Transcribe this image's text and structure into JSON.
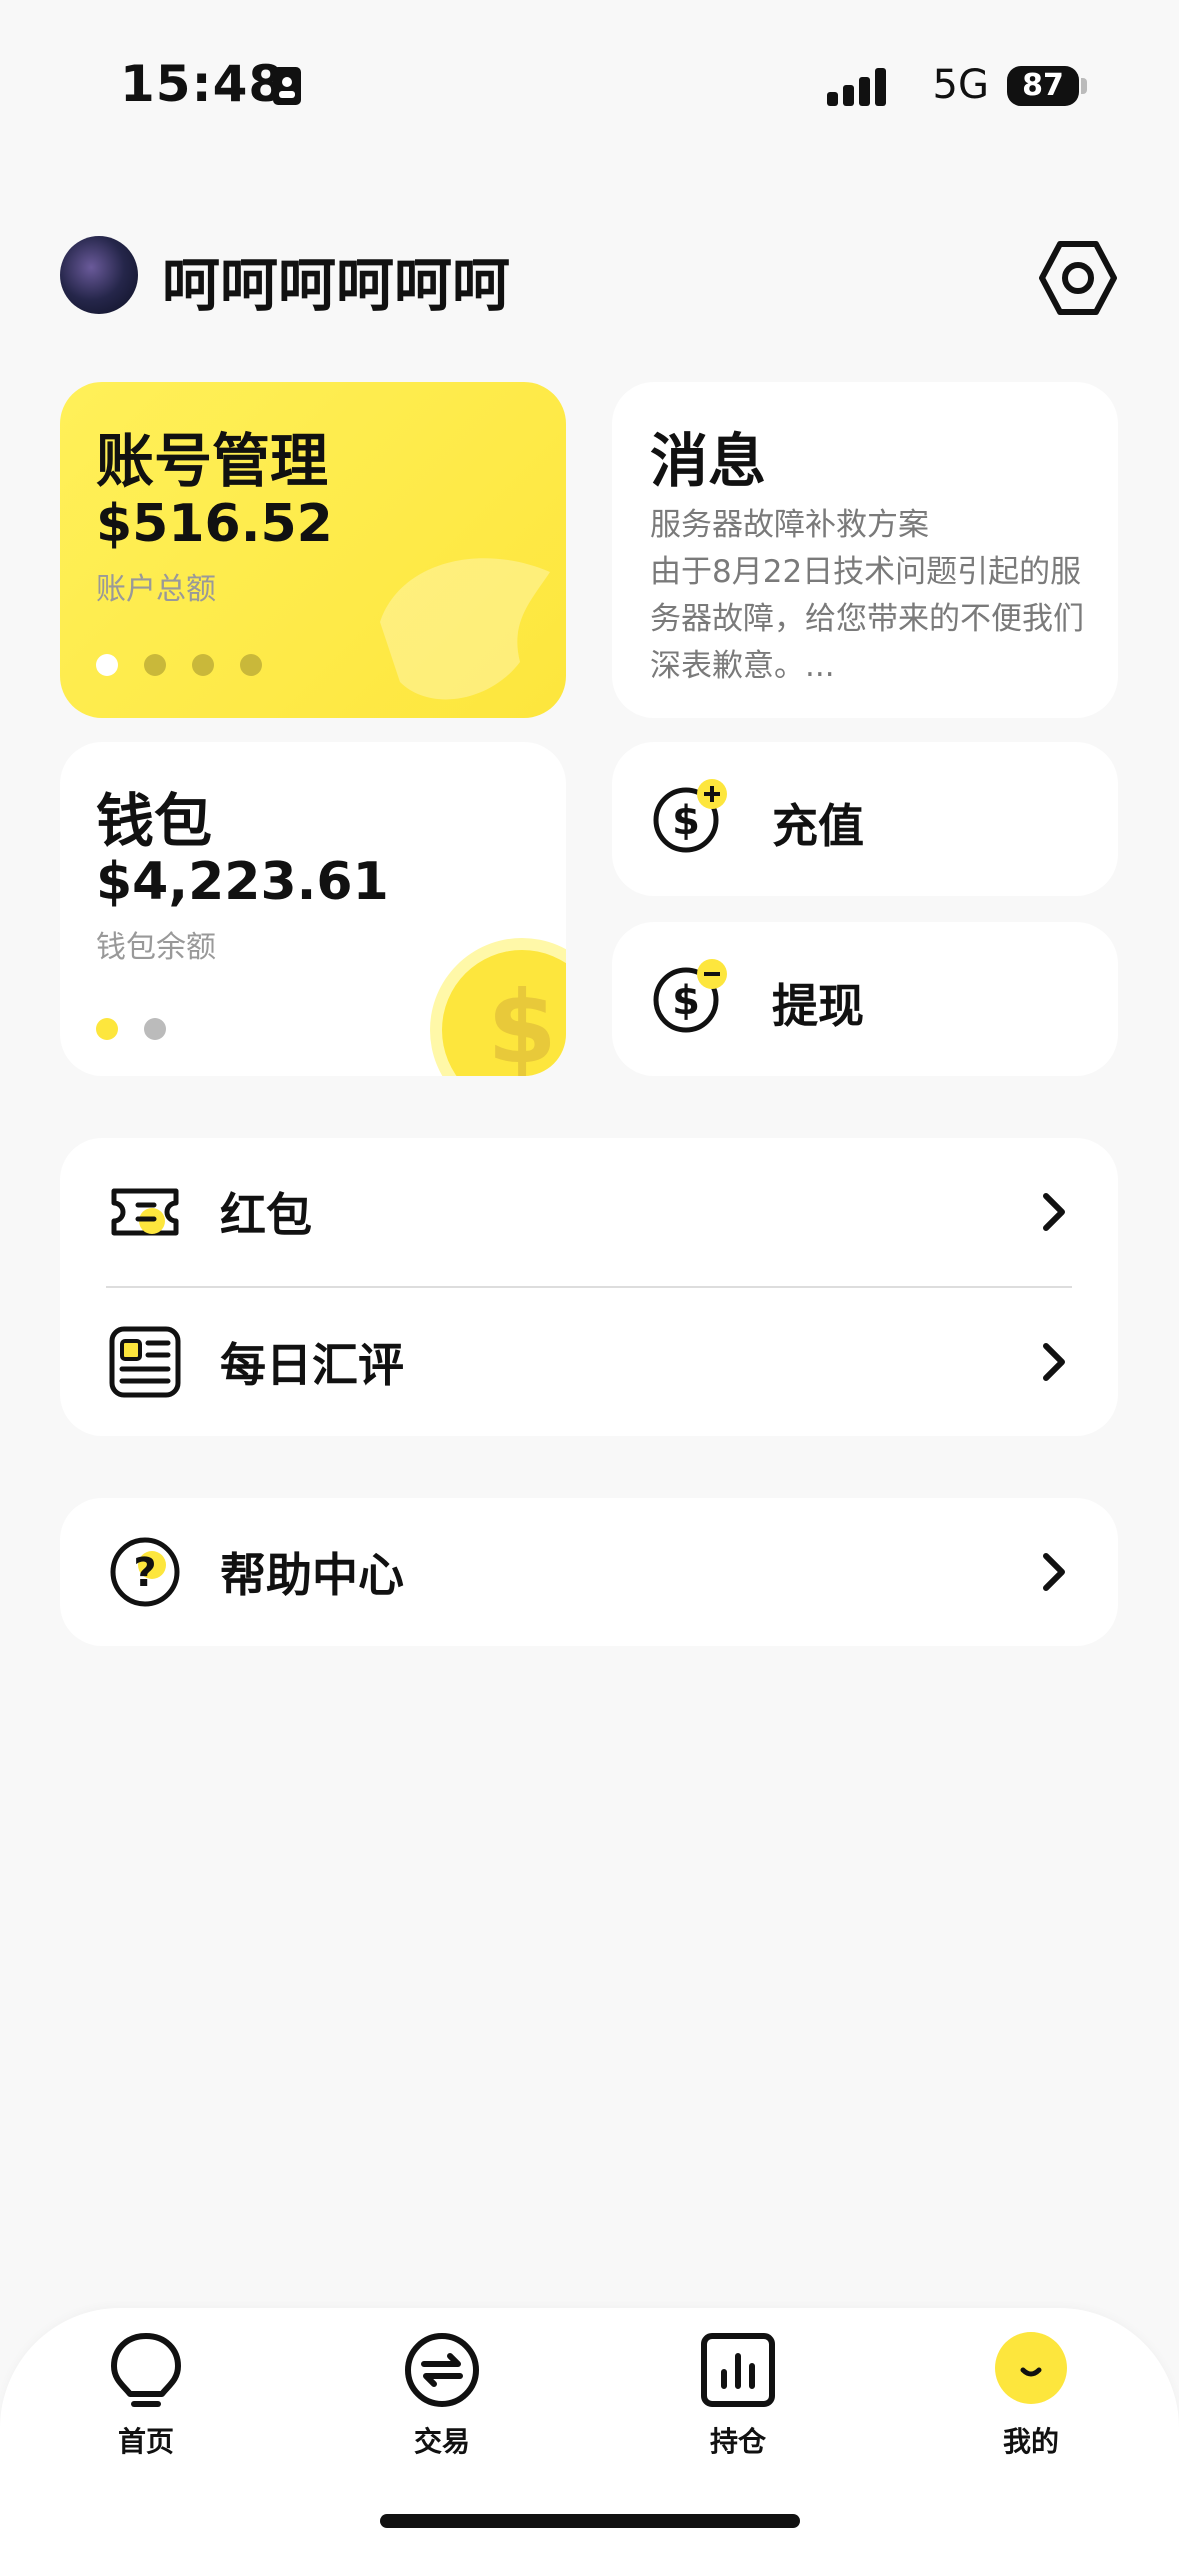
{
  "status": {
    "time": "15:48",
    "network": "5G",
    "battery": "87"
  },
  "profile": {
    "username": "呵呵呵呵呵呵"
  },
  "account_card": {
    "title": "账号管理",
    "amount": "$516.52",
    "subtitle": "账户总额"
  },
  "message_card": {
    "title": "消息",
    "body": "服务器故障补救方案\n由于8月22日技术问题引起的服务器故障，给您带来的不便我们深表歉意。..."
  },
  "wallet_card": {
    "title": "钱包",
    "amount": "$4,223.61",
    "subtitle": "钱包余额"
  },
  "actions": {
    "recharge": "充值",
    "withdraw": "提现"
  },
  "list1": [
    {
      "label": "红包"
    },
    {
      "label": "每日汇评"
    }
  ],
  "list2": [
    {
      "label": "帮助中心"
    }
  ],
  "tabs": [
    {
      "label": "首页",
      "icon": "bulb-icon"
    },
    {
      "label": "交易",
      "icon": "exchange-icon"
    },
    {
      "label": "持仓",
      "icon": "chart-icon"
    },
    {
      "label": "我的",
      "icon": "profile-icon"
    }
  ],
  "colors": {
    "accent": "#fde63d",
    "text": "#111111",
    "muted": "#999999",
    "background": "#f8f8f8"
  }
}
